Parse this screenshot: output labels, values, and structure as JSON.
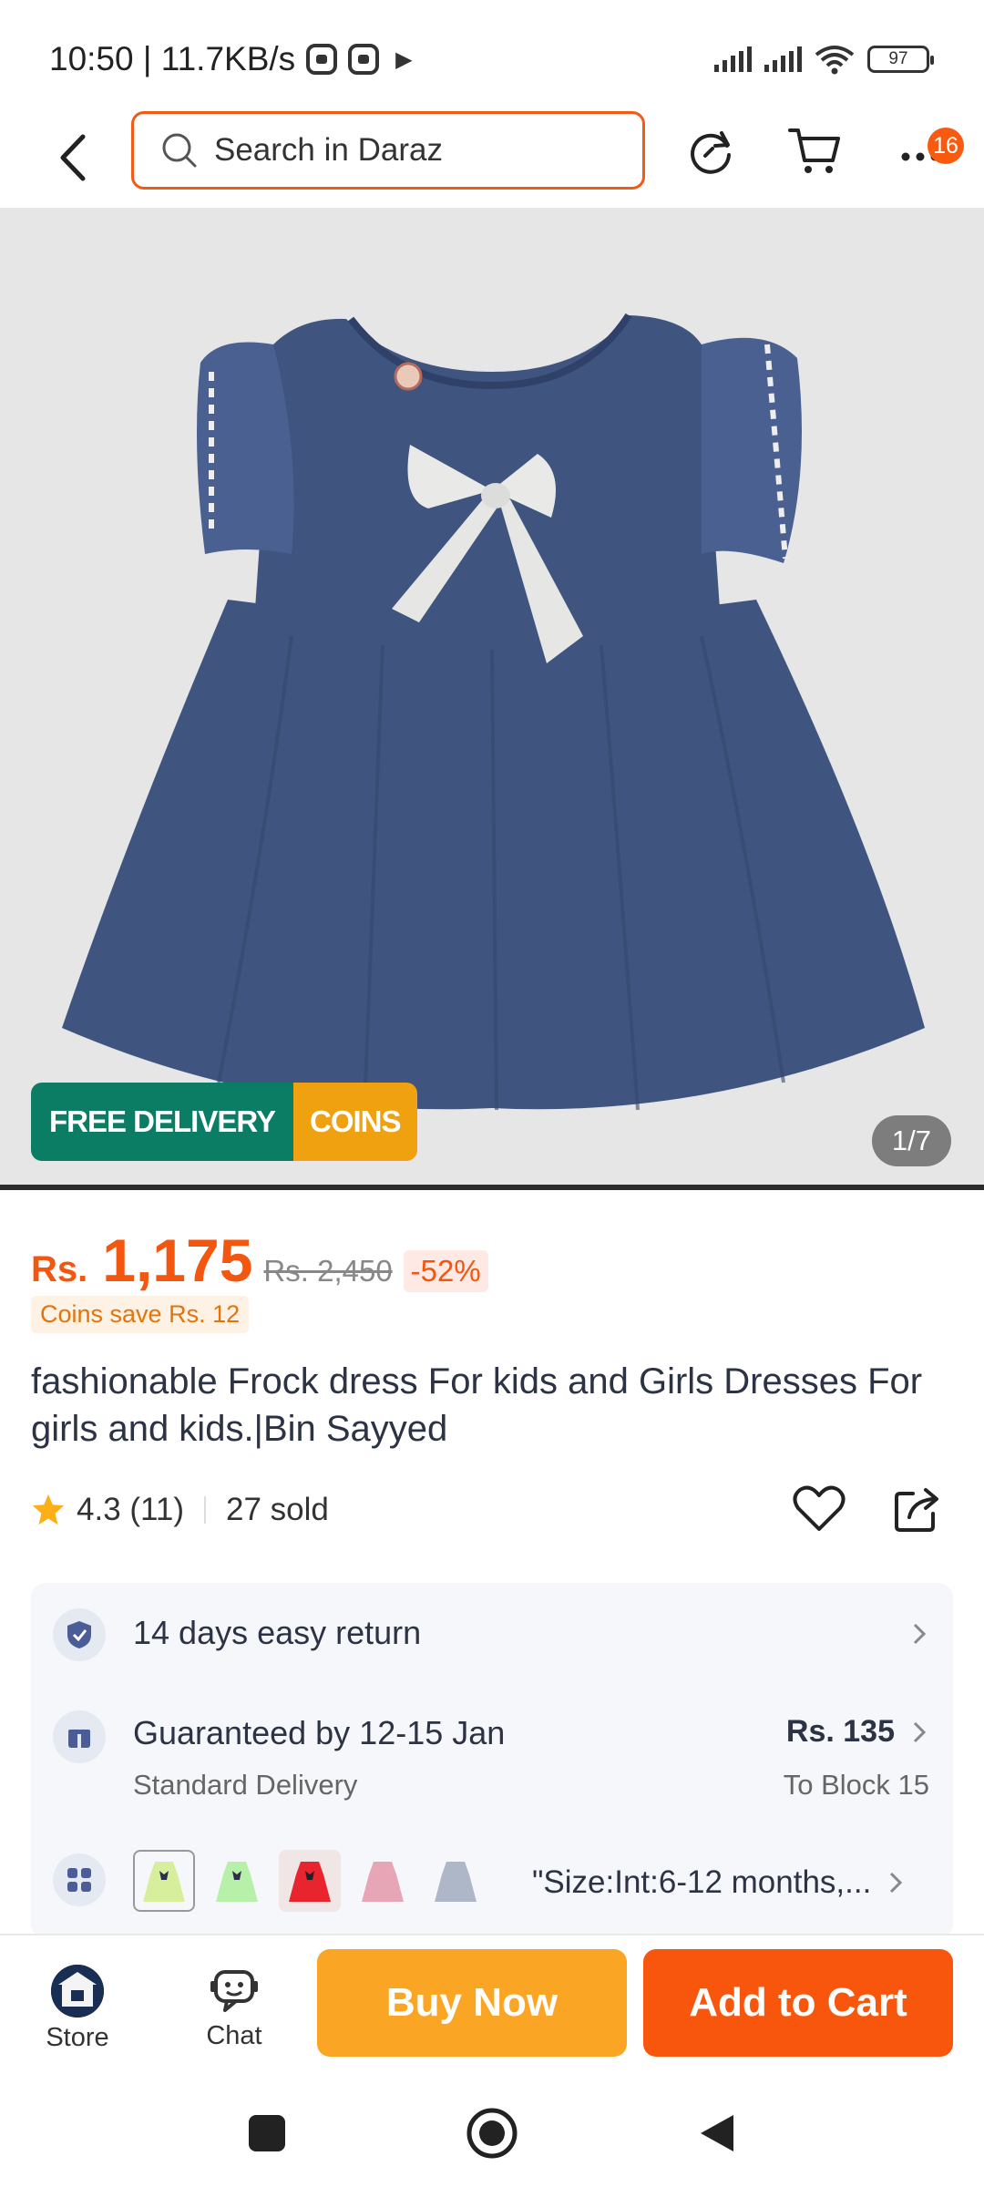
{
  "status_bar": {
    "time_speed": "10:50 | 11.7KB/s",
    "battery": "97"
  },
  "header": {
    "search_placeholder": "Search in Daraz",
    "more_badge": "16"
  },
  "gallery": {
    "tag_free_delivery": "FREE DELIVERY",
    "tag_coins": "COINS",
    "counter": "1/7"
  },
  "price": {
    "currency": "Rs.",
    "current": "1,175",
    "original": "Rs. 2,450",
    "discount": "-52%",
    "coins_save": "Coins save Rs. 12"
  },
  "product": {
    "title": "fashionable Frock dress For kids and Girls Dresses  For girls and kids.|Bin Sayyed",
    "rating": "4.3 (11)",
    "sold": "27 sold"
  },
  "info": {
    "return_text": "14 days easy return",
    "delivery_title": "Guaranteed by 12-15 Jan",
    "delivery_sub": "Standard Delivery",
    "delivery_price": "Rs. 135",
    "delivery_location": "To Block 15",
    "variant_text": "\"Size:Int:6-12 months,..."
  },
  "swatch_colors": [
    "#d7ef9c",
    "#b7f0a8",
    "#e8242e",
    "#e7a6b6",
    "#aeb7c8"
  ],
  "bottom": {
    "store_label": "Store",
    "chat_label": "Chat",
    "buy_now": "Buy Now",
    "add_to_cart": "Add to Cart"
  },
  "colors": {
    "accent": "#f8560d",
    "buy_now": "#fba524",
    "free_delivery": "#0a7d64",
    "coins": "#f0a10f",
    "dress": "#3f5580"
  }
}
